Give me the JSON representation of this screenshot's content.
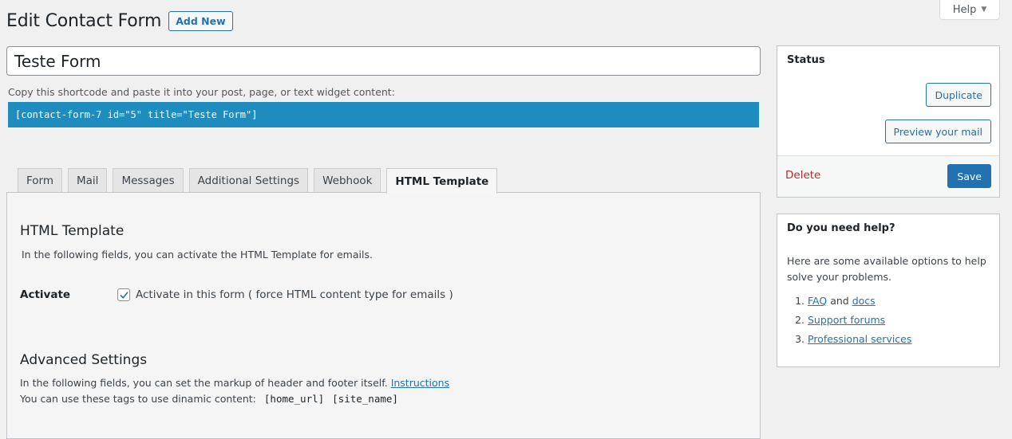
{
  "help_tab": {
    "label": "Help",
    "caret": "▼"
  },
  "header": {
    "title": "Edit Contact Form",
    "add_new_label": "Add New"
  },
  "form_title": {
    "value": "Teste Form"
  },
  "shortcode": {
    "label": "Copy this shortcode and paste it into your post, page, or text widget content:",
    "value": "[contact-form-7 id=\"5\" title=\"Teste Form\"]"
  },
  "tabs": [
    {
      "label": "Form",
      "active": false
    },
    {
      "label": "Mail",
      "active": false
    },
    {
      "label": "Messages",
      "active": false
    },
    {
      "label": "Additional Settings",
      "active": false
    },
    {
      "label": "Webhook",
      "active": false
    },
    {
      "label": "HTML Template",
      "active": true
    }
  ],
  "panel": {
    "heading": "HTML Template",
    "description": "In the following fields, you can activate the HTML Template for emails.",
    "activate_label": "Activate",
    "activate_checkbox": {
      "checked": true,
      "label": "Activate in this form ( force HTML content type for emails )"
    },
    "advanced_heading": "Advanced Settings",
    "advanced_description": "In the following fields, you can set the markup of header and footer itself.",
    "instructions_link": "Instructions",
    "tags_description": "You can use these tags to use dinamic content:",
    "tags": [
      "[home_url]",
      "[site_name]"
    ]
  },
  "status_box": {
    "title": "Status",
    "duplicate_label": "Duplicate",
    "preview_label": "Preview your mail",
    "delete_label": "Delete",
    "save_label": "Save"
  },
  "help_box": {
    "title": "Do you need help?",
    "text": "Here are some available options to help solve your problems.",
    "items": [
      {
        "link1": "FAQ",
        "connector": "and",
        "link2": "docs"
      },
      {
        "link1": "Support forums"
      },
      {
        "link1": "Professional services"
      }
    ]
  },
  "colors": {
    "accent": "#2271b1",
    "shortcode_bg": "#1e8cbe",
    "delete": "#b32d2e",
    "page_bg": "#f0f0f1"
  }
}
